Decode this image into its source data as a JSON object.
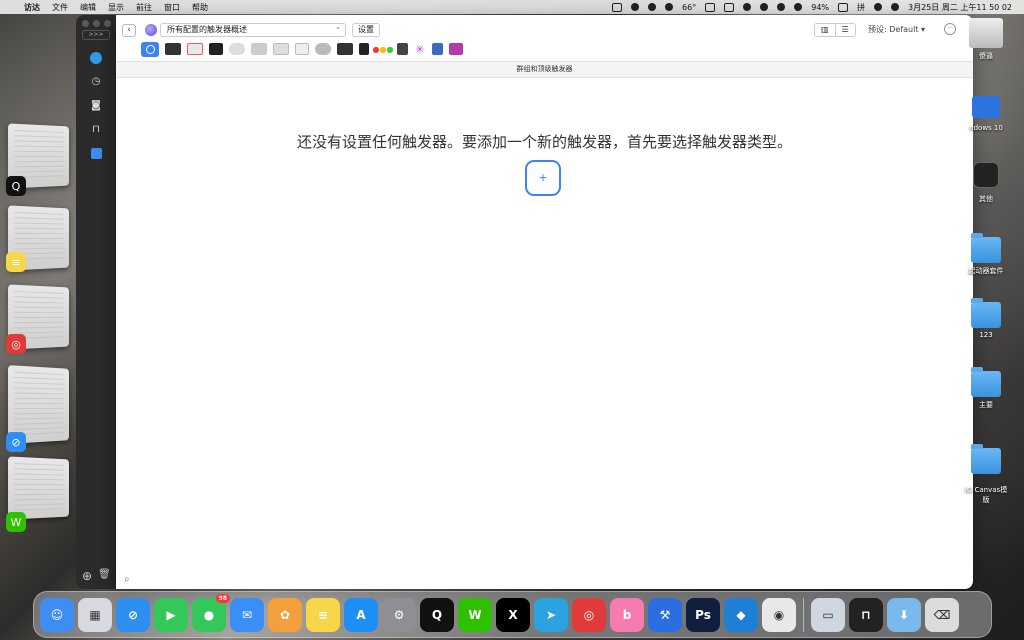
{
  "menubar": {
    "apple": "",
    "app_name": "访达",
    "menus": [
      "文件",
      "编辑",
      "显示",
      "前往",
      "窗口",
      "帮助"
    ],
    "status": {
      "temp": "66°",
      "battery": "94%",
      "input": "拼",
      "datetime": "3月25日 周二  上午11 50 02"
    }
  },
  "sidebar": {
    "collapse_label": ">>>",
    "icons": [
      "globe-icon",
      "clock-icon",
      "stop-icon",
      "rack-icon",
      "finder-icon"
    ],
    "add_glyph": "⊕",
    "trash_glyph": "🗑"
  },
  "toolbar": {
    "back_glyph": "‹",
    "select_value": "所有配置的触发器概述",
    "select_chevron": "⌃",
    "settings_label": "设置",
    "view_grid": "▥",
    "view_list": "☰",
    "preset_label": "预设: Default ▾",
    "more_glyph": "···"
  },
  "devices": [
    "touchbar",
    "keyboard",
    "trackpad",
    "mouse",
    "remote",
    "stream",
    "midi"
  ],
  "group_bar_label": "群组和顶级触发器",
  "empty_message": "还没有设置任何触发器。要添加一个新的触发器，首先要选择触发器类型。",
  "add_button_label": "+",
  "search_glyph": "⌕",
  "desktop_items": [
    {
      "label": "傻逼",
      "kind": "drive"
    },
    {
      "label": "ndows 10",
      "kind": "app"
    },
    {
      "label": "其他",
      "kind": "app"
    },
    {
      "label": "起动器套件",
      "kind": "folder"
    },
    {
      "label": "123",
      "kind": "folder"
    },
    {
      "label": "主要",
      "kind": "folder"
    },
    {
      "label": "IG Canvas模\n版",
      "kind": "folder"
    }
  ],
  "dock": {
    "apps": [
      {
        "name": "finder",
        "glyph": "☺",
        "color": "#3d8ef0"
      },
      {
        "name": "launchpad",
        "glyph": "▦",
        "color": "#d8d8e0"
      },
      {
        "name": "safari",
        "glyph": "⊘",
        "color": "#2f8ff0"
      },
      {
        "name": "facetime",
        "glyph": "▶",
        "color": "#34c759"
      },
      {
        "name": "messages",
        "glyph": "●",
        "color": "#34c759",
        "badge": "98"
      },
      {
        "name": "mail",
        "glyph": "✉",
        "color": "#3a8ef6"
      },
      {
        "name": "photos",
        "glyph": "✿",
        "color": "#f2a03b"
      },
      {
        "name": "notes",
        "glyph": "≡",
        "color": "#f7d64a"
      },
      {
        "name": "appstore",
        "glyph": "A",
        "color": "#1e8ff5"
      },
      {
        "name": "settings",
        "glyph": "⚙",
        "color": "#8e8e93"
      },
      {
        "name": "qq",
        "glyph": "Q",
        "color": "#111"
      },
      {
        "name": "wechat",
        "glyph": "W",
        "color": "#2dc100"
      },
      {
        "name": "x",
        "glyph": "X",
        "color": "#000"
      },
      {
        "name": "telegram",
        "glyph": "➤",
        "color": "#2aa3e0"
      },
      {
        "name": "netease",
        "glyph": "◎",
        "color": "#e03a3a"
      },
      {
        "name": "bilibili",
        "glyph": "b",
        "color": "#f57bb0"
      },
      {
        "name": "xcode",
        "glyph": "⚒",
        "color": "#2b6ee0"
      },
      {
        "name": "photoshop",
        "glyph": "Ps",
        "color": "#0f1f3d"
      },
      {
        "name": "vscode",
        "glyph": "◆",
        "color": "#1f7fd4"
      },
      {
        "name": "chrome",
        "glyph": "◉",
        "color": "#e8e8e8"
      }
    ],
    "right": [
      {
        "name": "preview",
        "glyph": "▭",
        "color": "#cfd6e0"
      },
      {
        "name": "btt",
        "glyph": "⊓",
        "color": "#222"
      },
      {
        "name": "downloads",
        "glyph": "⬇",
        "color": "#7bb8ec"
      },
      {
        "name": "trash",
        "glyph": "⌫",
        "color": "#dcdcdc"
      }
    ]
  }
}
